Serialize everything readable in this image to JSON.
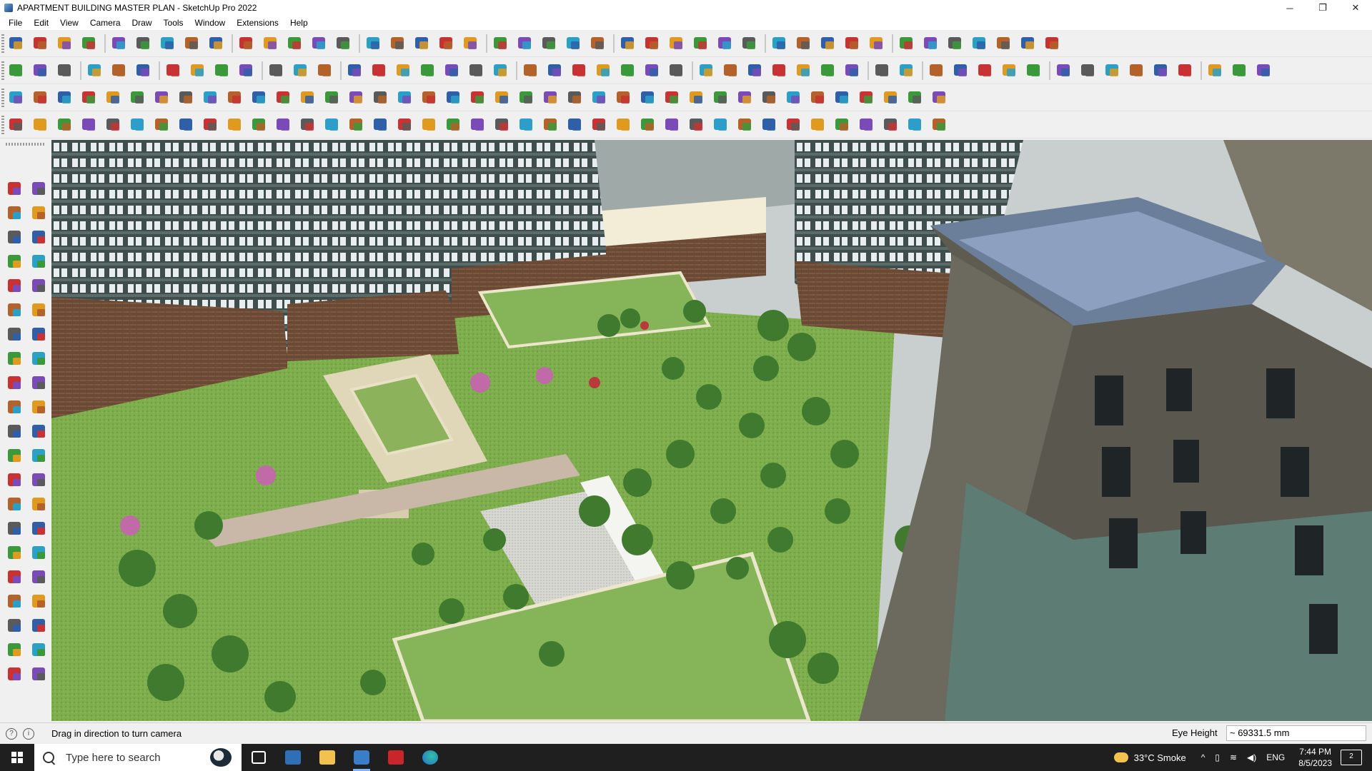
{
  "window": {
    "title": "APARTMENT BUILDING MASTER PLAN - SketchUp Pro 2022",
    "controls": {
      "minimize": "─",
      "restore": "❐",
      "close": "✕"
    }
  },
  "menubar": {
    "items": [
      "File",
      "Edit",
      "View",
      "Camera",
      "Draw",
      "Tools",
      "Window",
      "Extensions",
      "Help"
    ]
  },
  "colors": {
    "palette": [
      "#2f5fa8",
      "#c83232",
      "#e09a1e",
      "#3a9a3a",
      "#7a4ab8",
      "#5a5a5a",
      "#2aa0c8",
      "#b4622a"
    ]
  },
  "status": {
    "message": "Drag in direction to turn camera",
    "measurement_label": "Eye Height",
    "measurement_value": "~ 69331.5 mm"
  },
  "taskbar": {
    "search_placeholder": "Type here to search",
    "weather": "33°C  Smoke",
    "language": "ENG",
    "time": "7:44 PM",
    "date": "8/5/2023",
    "notification_count": "2"
  }
}
